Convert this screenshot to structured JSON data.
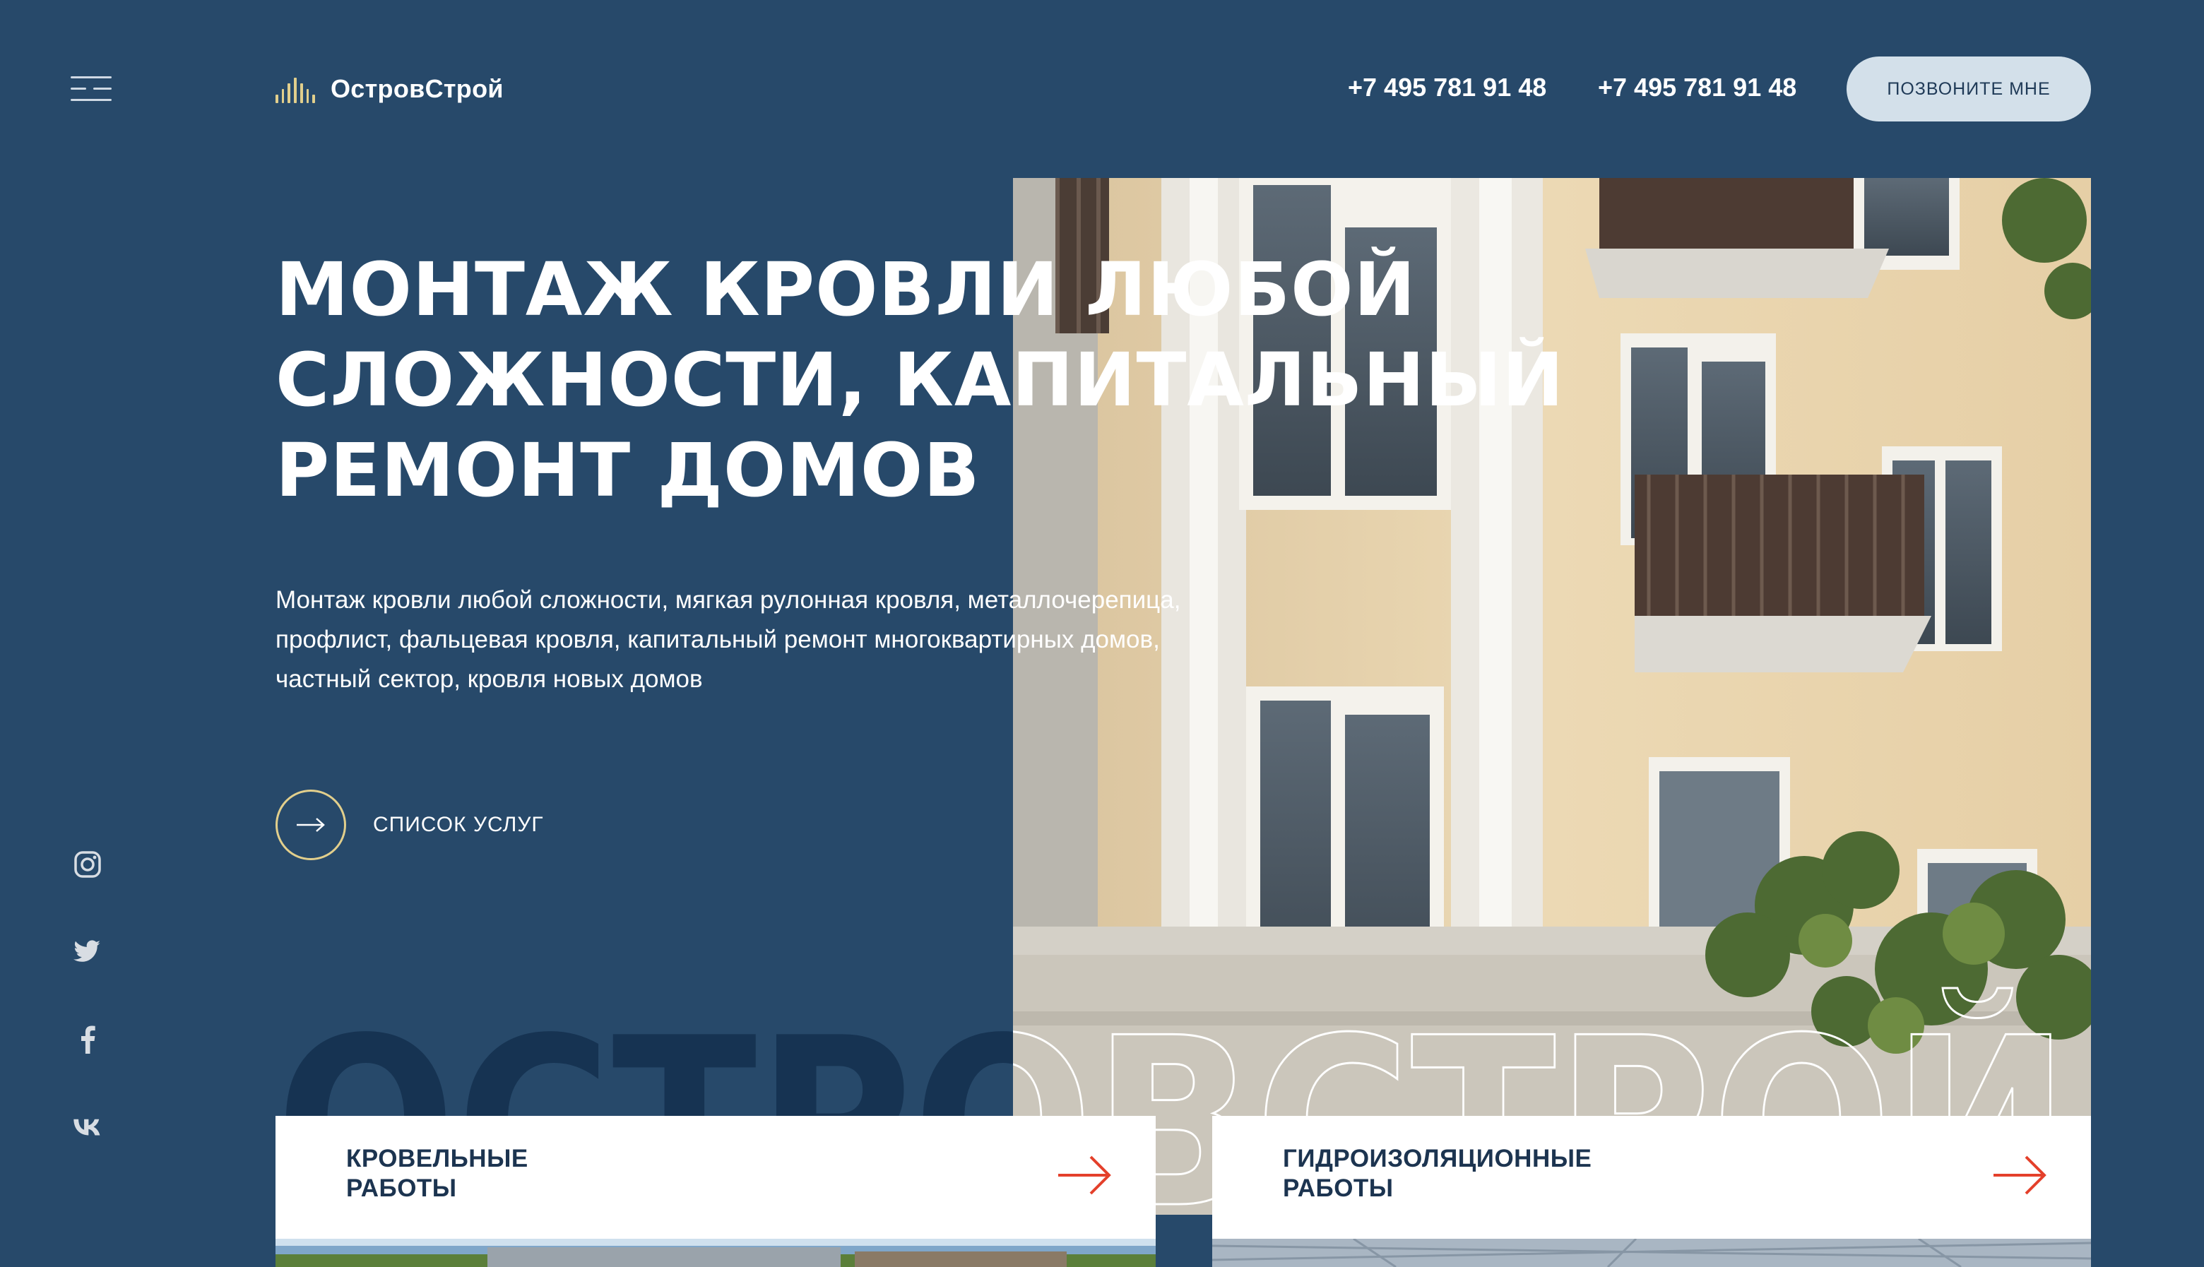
{
  "header": {
    "logo_text": "ОстровСтрой",
    "phone_1": "+7 495 781 91 48",
    "phone_2": "+7 495 781 91 48",
    "call_button": "ПОЗВОНИТЕ МНЕ"
  },
  "hero": {
    "title_lines": [
      "МОНТАЖ КРОВЛИ ЛЮБОЙ",
      "СЛОЖНОСТИ, КАПИТАЛЬНЫЙ",
      "РЕМОНТ ДОМОВ"
    ],
    "description": "Монтаж кровли любой сложности, мягкая рулонная кровля, металлочерепица, профлист, фальцевая кровля, капитальный ремонт многоквартирных домов, частный сектор, кровля новых домов",
    "services_link": "СПИСОК УСЛУГ",
    "watermark": "ОСТРОВСТРОЙ"
  },
  "social": [
    "instagram-icon",
    "twitter-icon",
    "facebook-icon",
    "vk-icon"
  ],
  "cards": [
    {
      "title": "КРОВЕЛЬНЫЕ\nРАБОТЫ",
      "icon": "arrow-right-icon"
    },
    {
      "title": "ГИДРОИЗОЛЯЦИОННЫЕ\nРАБОТЫ",
      "icon": "arrow-right-icon"
    }
  ],
  "colors": {
    "background": "#27496a",
    "accent_gold": "#e2cf8c",
    "accent_red": "#e4402b",
    "button_bg": "#d3e0ea",
    "card_text": "#1c3450"
  }
}
